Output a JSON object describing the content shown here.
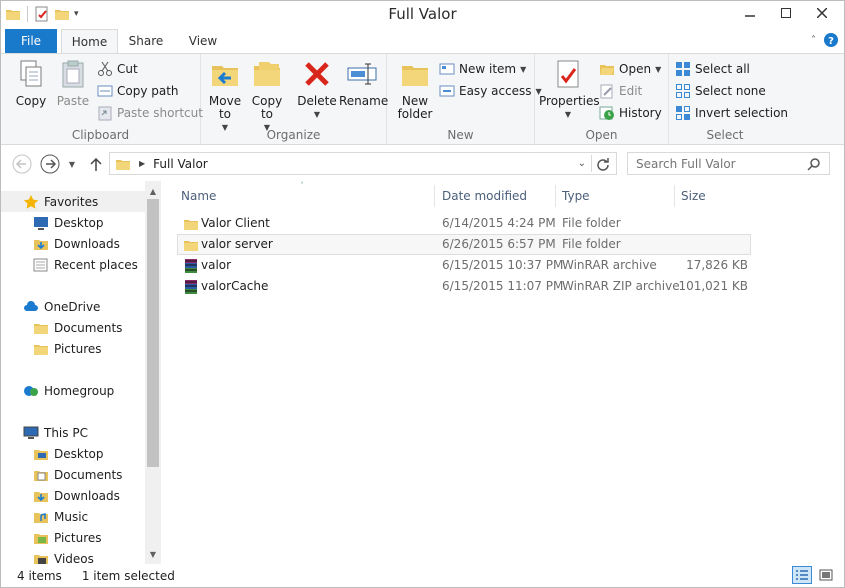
{
  "window": {
    "title": "Full Valor"
  },
  "tabs": [
    "File",
    "Home",
    "Share",
    "View"
  ],
  "ribbon": {
    "clipboard": {
      "label": "Clipboard",
      "copy": "Copy",
      "paste": "Paste",
      "cut": "Cut",
      "copy_path": "Copy path",
      "paste_shortcut": "Paste shortcut"
    },
    "organize": {
      "label": "Organize",
      "move_to_1": "Move",
      "move_to_2": "to",
      "copy_to_1": "Copy",
      "copy_to_2": "to",
      "delete": "Delete",
      "rename": "Rename"
    },
    "new": {
      "label": "New",
      "new_folder_1": "New",
      "new_folder_2": "folder",
      "new_item": "New item",
      "easy_access": "Easy access"
    },
    "open": {
      "label": "Open",
      "properties": "Properties",
      "open": "Open",
      "edit": "Edit",
      "history": "History"
    },
    "select": {
      "label": "Select",
      "select_all": "Select all",
      "select_none": "Select none",
      "invert": "Invert selection"
    }
  },
  "address": {
    "path": "Full Valor",
    "search_placeholder": "Search Full Valor"
  },
  "nav": {
    "favorites": "Favorites",
    "desktop": "Desktop",
    "downloads": "Downloads",
    "recent": "Recent places",
    "onedrive": "OneDrive",
    "documents": "Documents",
    "pictures": "Pictures",
    "homegroup": "Homegroup",
    "thispc": "This PC",
    "pc_desktop": "Desktop",
    "pc_documents": "Documents",
    "pc_downloads": "Downloads",
    "pc_music": "Music",
    "pc_pictures": "Pictures",
    "pc_videos": "Videos"
  },
  "columns": {
    "name": "Name",
    "date": "Date modified",
    "type": "Type",
    "size": "Size"
  },
  "files": [
    {
      "name": "Valor Client",
      "date": "6/14/2015 4:24 PM",
      "type": "File folder",
      "size": ""
    },
    {
      "name": "valor server",
      "date": "6/26/2015 6:57 PM",
      "type": "File folder",
      "size": ""
    },
    {
      "name": "valor",
      "date": "6/15/2015 10:37 PM",
      "type": "WinRAR archive",
      "size": "17,826 KB"
    },
    {
      "name": "valorCache",
      "date": "6/15/2015 11:07 PM",
      "type": "WinRAR ZIP archive",
      "size": "101,021 KB"
    }
  ],
  "status": {
    "count": "4 items",
    "selected": "1 item selected"
  },
  "colors": {
    "accent": "#1979ca",
    "folder": "#e8c25b"
  }
}
